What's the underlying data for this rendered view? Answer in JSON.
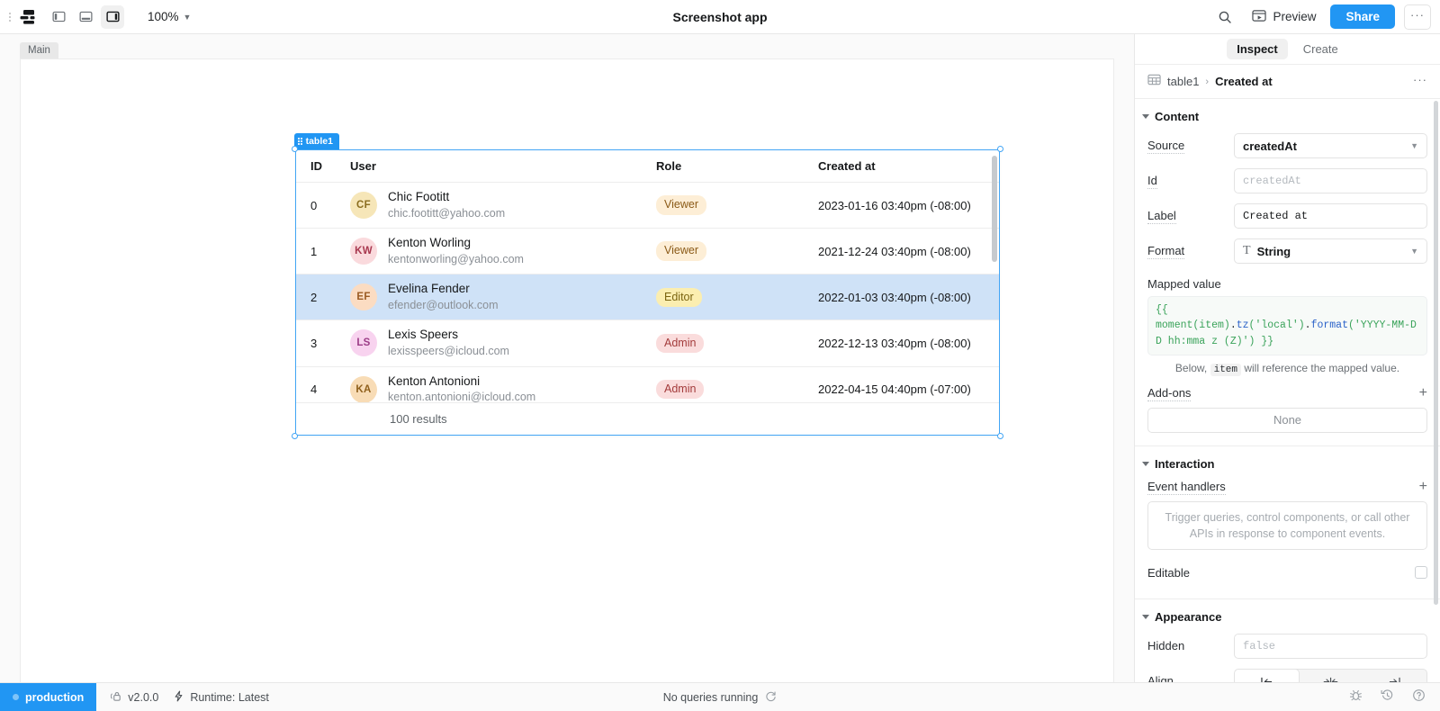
{
  "topbar": {
    "zoom": "100%",
    "title": "Screenshot app",
    "preview_label": "Preview",
    "share_label": "Share",
    "more_label": "···",
    "icons": {
      "logo": "app-logo-icon",
      "layout_left": "panel-left-icon",
      "layout_bottom": "panel-bottom-icon",
      "layout_right": "panel-right-icon",
      "search": "search-icon",
      "preview": "preview-window-icon",
      "caret": "chevron-down-icon"
    }
  },
  "canvas": {
    "page_tab": "Main",
    "component_badge": "table1"
  },
  "table": {
    "columns": [
      "ID",
      "User",
      "Role",
      "Created at"
    ],
    "rows": [
      {
        "id": "0",
        "initials": "CF",
        "name": "Chic Footitt",
        "email": "chic.footitt@yahoo.com",
        "role": "Viewer",
        "created": "2023-01-16 03:40pm (-08:00)",
        "selected": false
      },
      {
        "id": "1",
        "initials": "KW",
        "name": "Kenton Worling",
        "email": "kentonworling@yahoo.com",
        "role": "Viewer",
        "created": "2021-12-24 03:40pm (-08:00)",
        "selected": false
      },
      {
        "id": "2",
        "initials": "EF",
        "name": "Evelina Fender",
        "email": "efender@outlook.com",
        "role": "Editor",
        "created": "2022-01-03 03:40pm (-08:00)",
        "selected": true
      },
      {
        "id": "3",
        "initials": "LS",
        "name": "Lexis Speers",
        "email": "lexisspeers@icloud.com",
        "role": "Admin",
        "created": "2022-12-13 03:40pm (-08:00)",
        "selected": false
      },
      {
        "id": "4",
        "initials": "KA",
        "name": "Kenton Antonioni",
        "email": "kenton.antonioni@icloud.com",
        "role": "Admin",
        "created": "2022-04-15 04:40pm (-07:00)",
        "selected": false
      }
    ],
    "footer": "100 results"
  },
  "colors": {
    "accent": "#2196f3",
    "selected_row": "#cfe2f7",
    "badge_viewer_bg": "#fdeed6",
    "badge_viewer_fg": "#8a5a17",
    "badge_editor_bg": "#fbeeb0",
    "badge_editor_fg": "#7a6410",
    "badge_admin_bg": "#fadcdc",
    "badge_admin_fg": "#a33b3b",
    "avatar_0_bg": "#f6e6b8",
    "avatar_0_fg": "#8a6d1f",
    "avatar_1_bg": "#fadadd",
    "avatar_1_fg": "#a8384f",
    "avatar_2_bg": "#fbdcc2",
    "avatar_2_fg": "#9a5a22",
    "avatar_3_bg": "#f8d3ef",
    "avatar_3_fg": "#9c3c87",
    "avatar_4_bg": "#f8dcb6",
    "avatar_4_fg": "#8f5f1b"
  },
  "panel": {
    "tabs": [
      {
        "label": "Inspect",
        "active": true
      },
      {
        "label": "Create",
        "active": false
      }
    ],
    "breadcrumb": {
      "parent": "table1",
      "separator": "›",
      "current": "Created at",
      "more": "···"
    },
    "content": {
      "title": "Content",
      "source_label": "Source",
      "source_value": "createdAt",
      "id_label": "Id",
      "id_placeholder": "createdAt",
      "label_label": "Label",
      "label_value": "Created at",
      "format_label": "Format",
      "format_value": "String",
      "mapped_value_label": "Mapped value",
      "mapped_value_code": "{{ moment(item).tz('local').format('YYYY-MM-DD hh:mma z (Z)') }}",
      "mapped_code_parts": {
        "open": "{{",
        "fn": "moment(item)",
        "dot1": ".",
        "tz": "tz",
        "arg1": "('local')",
        "dot2": ".",
        "format": "format",
        "arg2": "('YYYY-MM-DD hh:mma z (Z)')",
        "close": " }}"
      },
      "hint_pre": "Below,",
      "hint_code": "item",
      "hint_post": "will reference the mapped value.",
      "addons_label": "Add-ons",
      "addons_value": "None",
      "addons_plus": "+"
    },
    "interaction": {
      "title": "Interaction",
      "event_handlers_label": "Event handlers",
      "event_handlers_plus": "+",
      "event_handlers_placeholder": "Trigger queries, control components, or call other APIs in response to component events.",
      "editable_label": "Editable",
      "editable_checked": false
    },
    "appearance": {
      "title": "Appearance",
      "hidden_label": "Hidden",
      "hidden_placeholder": "false",
      "align_label": "Align",
      "align_options": [
        "align-left",
        "align-center",
        "align-right"
      ],
      "align_selected": 0
    }
  },
  "statusbar": {
    "env": "production",
    "version": "v2.0.0",
    "runtime": "Runtime: Latest",
    "queries": "No queries running",
    "icons": {
      "refresh": "refresh-icon",
      "bug": "bug-icon",
      "history": "history-icon",
      "help": "help-circle-icon",
      "lock": "lock-icon",
      "bolt": "lightning-bolt-icon"
    }
  }
}
